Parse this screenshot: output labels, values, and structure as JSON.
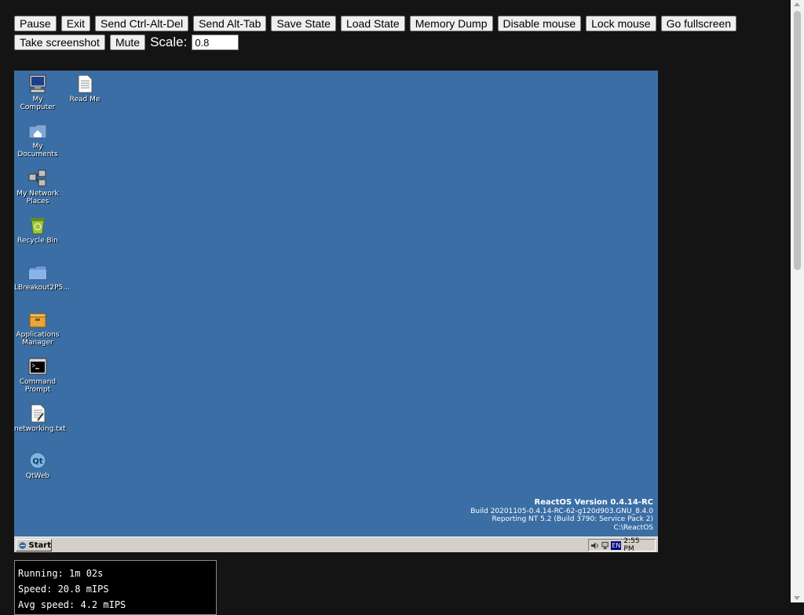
{
  "toolbar": {
    "row1": [
      "Pause",
      "Exit",
      "Send Ctrl-Alt-Del",
      "Send Alt-Tab",
      "Save State",
      "Load State",
      "Memory Dump",
      "Disable mouse",
      "Lock mouse",
      "Go fullscreen"
    ],
    "row2": [
      "Take screenshot",
      "Mute"
    ],
    "scale_label": "Scale:",
    "scale_value": "0.8"
  },
  "desktop": {
    "icons": [
      {
        "label": "My Computer",
        "icon": "computer-icon"
      },
      {
        "label": "My Documents",
        "icon": "documents-folder-icon"
      },
      {
        "label": "My Network Places",
        "icon": "network-icon"
      },
      {
        "label": "Recycle Bin",
        "icon": "recycle-bin-icon"
      },
      {
        "label": "LBreakout2P5...",
        "icon": "folder-icon"
      },
      {
        "label": "Applications Manager",
        "icon": "applications-manager-icon"
      },
      {
        "label": "Command Prompt",
        "icon": "command-prompt-icon"
      },
      {
        "label": "networking.txt",
        "icon": "text-file-icon"
      },
      {
        "label": "QtWeb",
        "icon": "qtweb-icon"
      },
      {
        "label": "Read Me",
        "icon": "readme-icon"
      }
    ],
    "version_lines": [
      "ReactOS Version 0.4.14-RC",
      "Build 20201105-0.4.14-RC-62-g120d903.GNU_8.4.0",
      "Reporting NT 5.2 (Build 3790: Service Pack 2)",
      "C:\\ReactOS"
    ],
    "colors": {
      "desktop_bg": "#3a6ea5",
      "taskbar_bg": "#d4d0c8"
    }
  },
  "taskbar": {
    "start_label": "Start",
    "language": "EN",
    "clock": "2:55 PM"
  },
  "stats": {
    "running": "Running: 1m 02s",
    "speed": "Speed: 20.8 mIPS",
    "avg_speed": "Avg speed: 4.2 mIPS"
  }
}
